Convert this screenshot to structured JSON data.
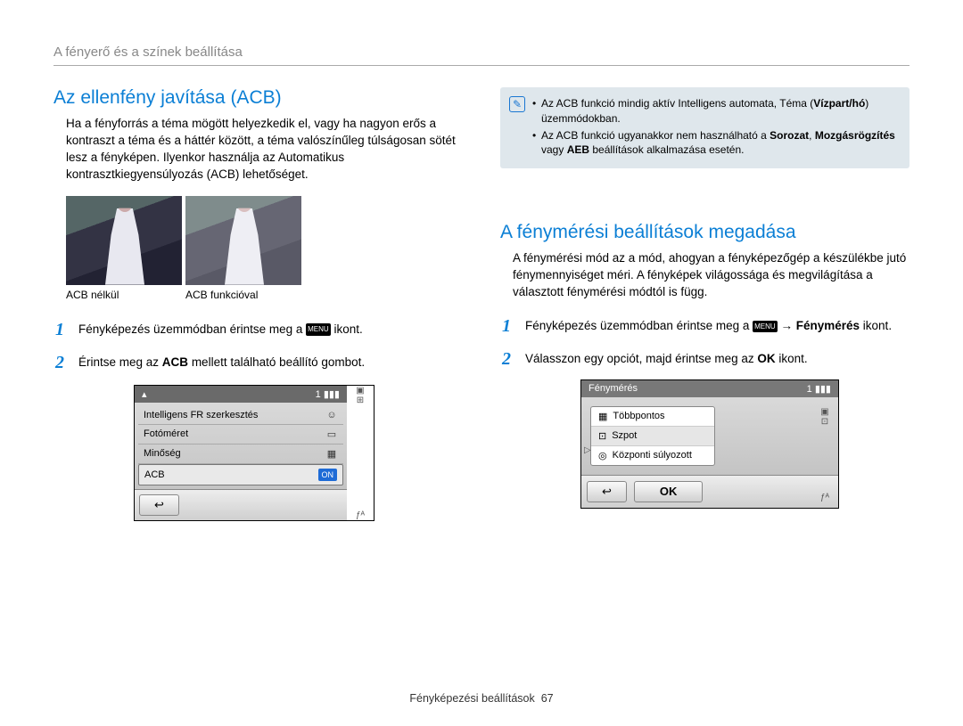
{
  "header": "A fényerő és a színek beállítása",
  "left": {
    "title": "Az ellenfény javítása (ACB)",
    "para": "Ha a fényforrás a téma mögött helyezkedik el, vagy ha nagyon erős a kontraszt a téma és a háttér között, a téma valószínűleg túlságosan sötét lesz a fényképen. Ilyenkor használja az Automatikus kontrasztkiegyensúlyozás (ACB) lehetőséget.",
    "cap1": "ACB nélkül",
    "cap2": "ACB funkcióval",
    "step1_a": "Fényképezés üzemmódban érintse meg a ",
    "step1_menu": "MENU",
    "step1_b": " ikont.",
    "step2_a": "Érintse meg az ",
    "step2_bold": "ACB",
    "step2_b": " mellett található beállító gombot.",
    "cam": {
      "count": "1",
      "rows": {
        "r1": "Intelligens FR szerkesztés",
        "r2": "Fotóméret",
        "r3": "Minőség",
        "r4": "ACB",
        "on": "ON"
      }
    }
  },
  "right": {
    "info1_a": "Az ACB funkció mindig aktív Intelligens automata, Téma (",
    "info1_bold": "Vízpart/hó",
    "info1_b": ") üzemmódokban.",
    "info2_a": "Az ACB funkció ugyanakkor nem használható a ",
    "info2_bold1": "Sorozat",
    "info2_mid": ", ",
    "info2_bold2": "Mozgásrögzítés",
    "info2_mid2": " vagy ",
    "info2_bold3": "AEB",
    "info2_b": " beállítások alkalmazása esetén.",
    "title": "A fénymérési beállítások megadása",
    "para": "A fénymérési mód az a mód, ahogyan a fényképezőgép a készülékbe jutó fénymennyiséget méri. A fényképek világossága és megvilágítása a választott fénymérési módtól is függ.",
    "step1_a": "Fényképezés üzemmódban érintse meg a ",
    "step1_menu": "MENU",
    "step1_arrow": " → ",
    "step1_bold": "Fénymérés",
    "step1_b": " ikont.",
    "step2_a": "Válasszon egy opciót, majd érintse meg az ",
    "step2_ok": "OK",
    "step2_b": " ikont.",
    "cam": {
      "title": "Fénymérés",
      "count": "1",
      "m1": "Többpontos",
      "m2": "Szpot",
      "m3": "Központi súlyozott",
      "ok": "OK"
    }
  },
  "footer_a": "Fényképezési beállítások",
  "footer_page": "67"
}
